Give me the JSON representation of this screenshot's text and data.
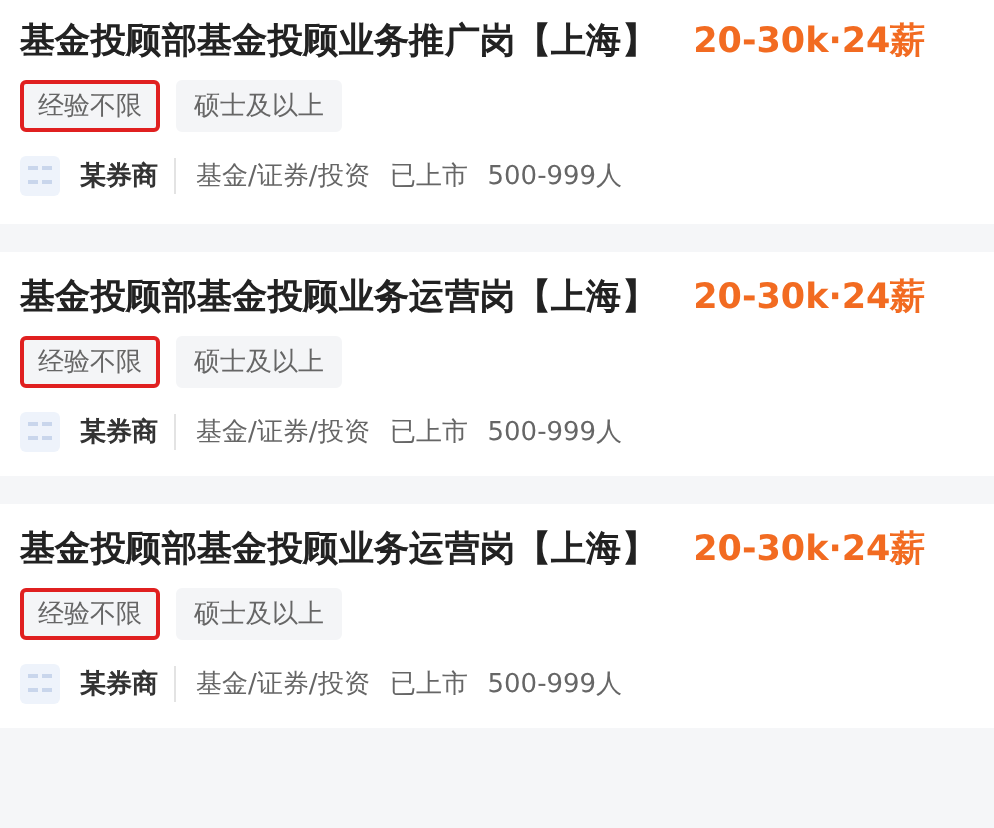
{
  "jobs": [
    {
      "title": "基金投顾部基金投顾业务推广岗【上海】",
      "salary": "20-30k·24薪",
      "tags": [
        {
          "label": "经验不限",
          "highlighted": true
        },
        {
          "label": "硕士及以上",
          "highlighted": false
        }
      ],
      "company": "某券商",
      "details": [
        "基金/证券/投资",
        "已上市",
        "500-999人"
      ]
    },
    {
      "title": "基金投顾部基金投顾业务运营岗【上海】",
      "salary": "20-30k·24薪",
      "tags": [
        {
          "label": "经验不限",
          "highlighted": true
        },
        {
          "label": "硕士及以上",
          "highlighted": false
        }
      ],
      "company": "某券商",
      "details": [
        "基金/证券/投资",
        "已上市",
        "500-999人"
      ]
    },
    {
      "title": "基金投顾部基金投顾业务运营岗【上海】",
      "salary": "20-30k·24薪",
      "tags": [
        {
          "label": "经验不限",
          "highlighted": true
        },
        {
          "label": "硕士及以上",
          "highlighted": false
        }
      ],
      "company": "某券商",
      "details": [
        "基金/证券/投资",
        "已上市",
        "500-999人"
      ]
    }
  ]
}
